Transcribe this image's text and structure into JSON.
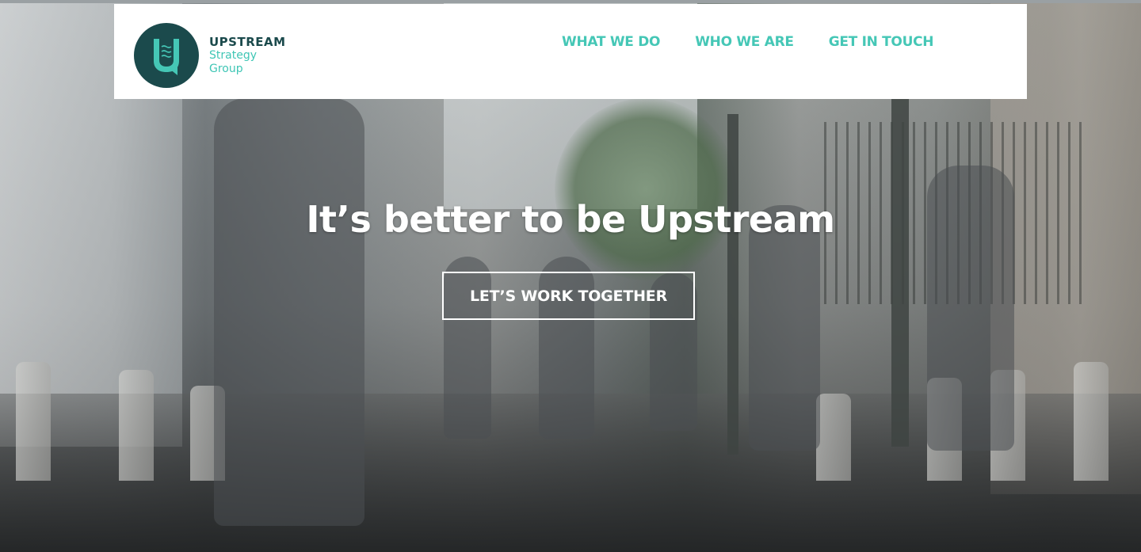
{
  "brand": {
    "name_line1": "UPSTREAM",
    "name_line2": "Strategy",
    "name_line3": "Group",
    "logo_letter": "U",
    "logo_color": "#1b4a4c",
    "accent_color": "#45c7b6"
  },
  "nav": {
    "items": [
      {
        "label": "WHAT WE DO"
      },
      {
        "label": "WHO WE ARE"
      },
      {
        "label": "GET IN TOUCH"
      }
    ]
  },
  "hero": {
    "headline": "It’s better to be Upstream",
    "cta_label": "LET’S WORK TOGETHER"
  }
}
